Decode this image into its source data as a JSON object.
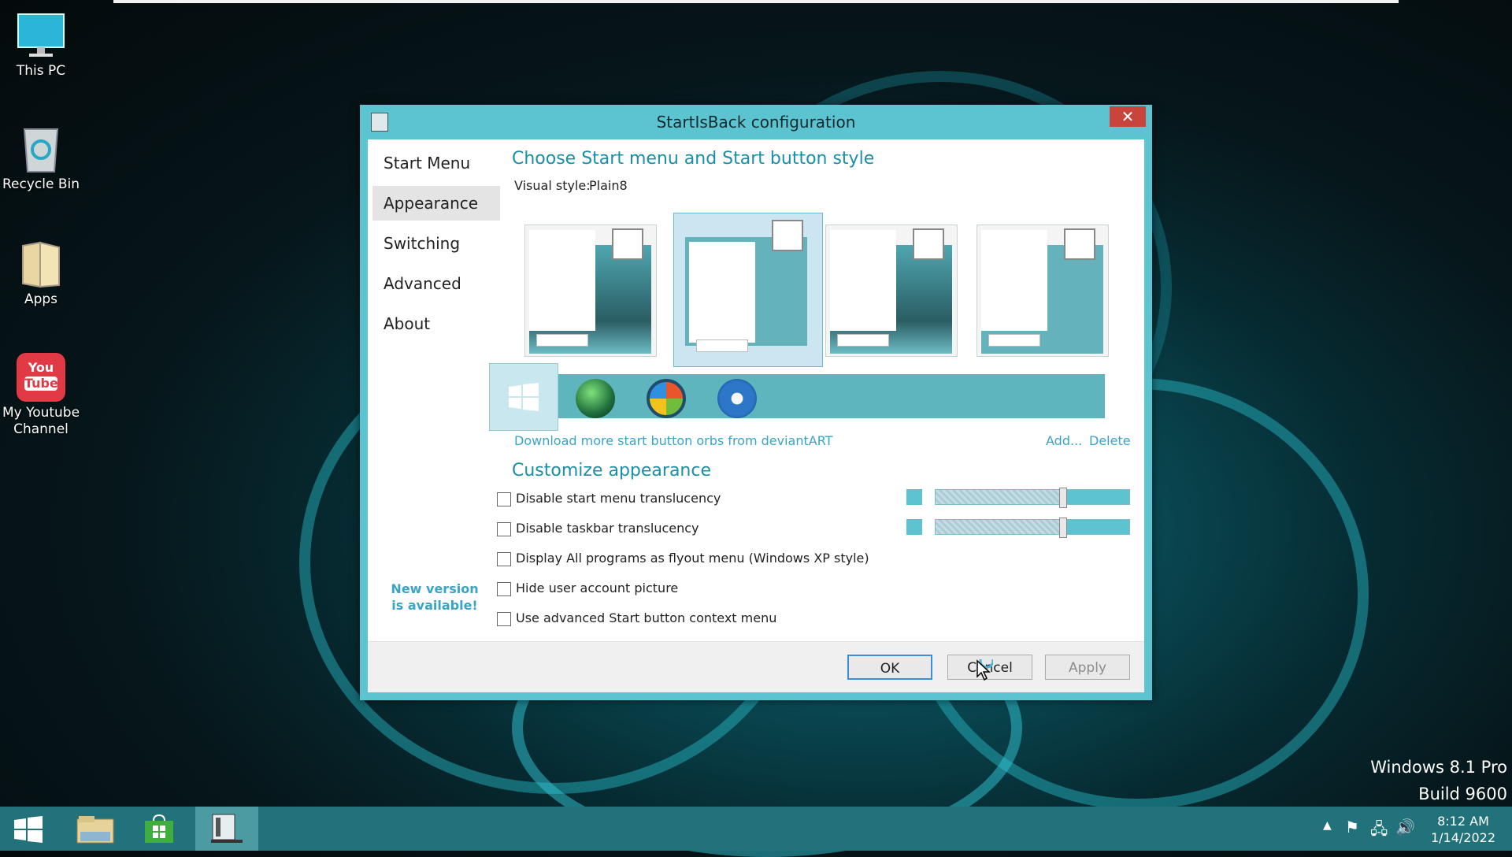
{
  "desktop": {
    "icons": [
      {
        "label": "This PC",
        "icon": "monitor-icon"
      },
      {
        "label": "Recycle Bin",
        "icon": "recycle-bin-icon"
      },
      {
        "label": "Apps",
        "icon": "folder-icon"
      },
      {
        "label": "My Youtube Channel",
        "icon": "youtube-icon",
        "glyph_top": "You",
        "glyph_bottom": "Tube"
      }
    ],
    "watermark": {
      "line1": "Windows 8.1 Pro",
      "line2": "Build 9600"
    }
  },
  "dialog": {
    "title": "StartIsBack configuration",
    "close_glyph": "✕",
    "nav": [
      {
        "label": "Start Menu",
        "selected": false
      },
      {
        "label": "Appearance",
        "selected": true
      },
      {
        "label": "Switching",
        "selected": false
      },
      {
        "label": "Advanced",
        "selected": false
      },
      {
        "label": "About",
        "selected": false
      }
    ],
    "new_version": "New version is available!",
    "style_heading": "Choose Start menu and Start button style",
    "visual_style_label": "Visual style:",
    "visual_style_value": "Plain8",
    "styles": [
      {
        "selected": false
      },
      {
        "selected": true
      },
      {
        "selected": false
      },
      {
        "selected": false
      }
    ],
    "orbs": [
      {
        "icon": "windows8-logo-icon",
        "selected": true
      },
      {
        "icon": "clover-orb-icon",
        "selected": false
      },
      {
        "icon": "windows-orb-icon",
        "selected": false
      },
      {
        "icon": "windows7-orb-icon",
        "selected": false
      }
    ],
    "download_link": "Download more start button orbs from deviantART",
    "add_link": "Add...",
    "delete_link": "Delete",
    "customize_heading": "Customize appearance",
    "checkboxes": [
      {
        "label": "Disable start menu translucency",
        "checked": false
      },
      {
        "label": "Disable taskbar translucency",
        "checked": false
      },
      {
        "label": "Display All programs as flyout menu (Windows XP style)",
        "checked": false
      },
      {
        "label": "Hide user account picture",
        "checked": false
      },
      {
        "label": "Use advanced Start button context menu",
        "checked": false
      }
    ],
    "color_swatch": "#5ec3d1",
    "buttons": {
      "ok": "OK",
      "cancel": "Cancel",
      "apply": "Apply"
    }
  },
  "taskbar": {
    "items": [
      {
        "icon": "start-windows-icon"
      },
      {
        "icon": "file-explorer-icon"
      },
      {
        "icon": "store-icon"
      },
      {
        "icon": "startisback-config-icon",
        "active": true
      }
    ],
    "clock": {
      "time": "8:12 AM",
      "date": "1/14/2022"
    }
  }
}
